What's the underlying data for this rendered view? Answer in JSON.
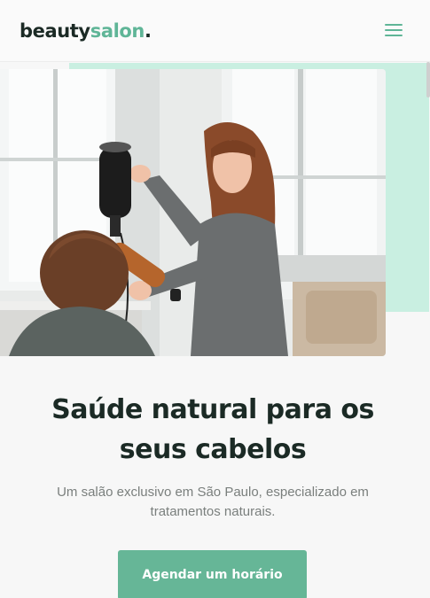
{
  "header": {
    "logo_part1": "beauty",
    "logo_part2": "salon",
    "logo_dot": ".",
    "menu_icon": "hamburger-menu-icon"
  },
  "hero": {
    "image_subject": "hairdresser blow-drying a client's hair in a salon",
    "accent_color": "#c9efe1"
  },
  "main": {
    "title": "Saúde natural para os seus cabelos",
    "subtitle": "Um salão exclusivo em São Paulo, especializado em tratamentos naturais.",
    "cta_label": "Agendar um horário"
  },
  "colors": {
    "brand": "#5fb597",
    "button": "#66b697",
    "text_dark": "#1b2a25",
    "text_muted": "#7a7f7d"
  }
}
